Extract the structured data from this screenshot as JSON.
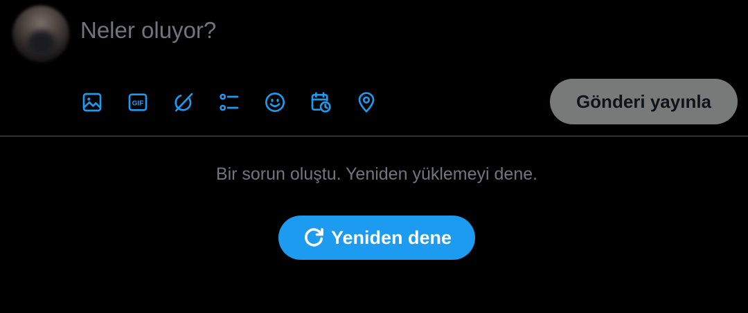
{
  "composer": {
    "placeholder": "Neler oluyor?",
    "post_button_label": "Gönderi yayınla",
    "tools": [
      {
        "icon": "image-icon"
      },
      {
        "icon": "gif-icon"
      },
      {
        "icon": "grok-icon"
      },
      {
        "icon": "poll-icon"
      },
      {
        "icon": "emoji-icon"
      },
      {
        "icon": "schedule-icon"
      },
      {
        "icon": "location-icon"
      }
    ],
    "gif_label": "GIF"
  },
  "error": {
    "message": "Bir sorun oluştu. Yeniden yüklemeyi dene.",
    "retry_label": "Yeniden dene"
  },
  "colors": {
    "background": "#000000",
    "accent": "#1d9bf0",
    "muted_text": "#71767b",
    "disabled_button": "#787a7a",
    "divider": "#2f3336"
  }
}
